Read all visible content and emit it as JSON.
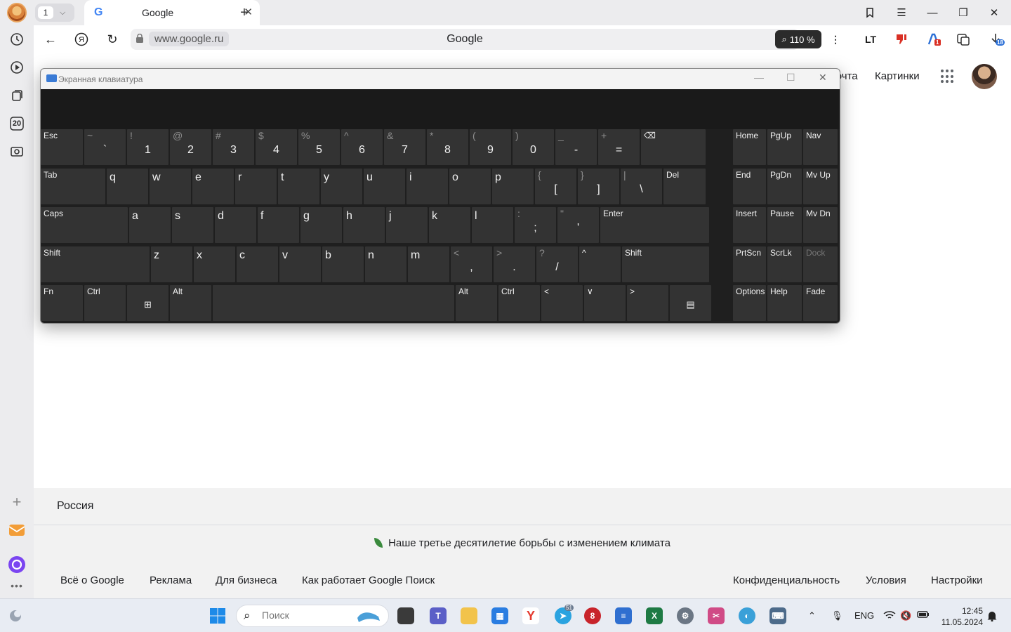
{
  "browser": {
    "tab_count": "1",
    "active_tab_title": "Google",
    "url": "www.google.ru",
    "page_title": "Google",
    "zoom_level": "110 %",
    "sidebar_calendar_number": "20",
    "download_badge": "18",
    "ext_badge": "1"
  },
  "google": {
    "header_mail": "Почта",
    "header_images": "Картинки"
  },
  "footer": {
    "country": "Россия",
    "climate_text": "Наше третье десятилетие борьбы с изменением климата",
    "links_left": [
      "Всё о Google",
      "Реклама",
      "Для бизнеса",
      "Как работает Google Поиск"
    ],
    "links_right": [
      "Конфиденциальность",
      "Условия",
      "Настройки"
    ]
  },
  "osk": {
    "window_title": "Экранная клавиатура",
    "row1": [
      {
        "label": "Esc"
      },
      {
        "top": "~",
        "bottom": "`"
      },
      {
        "top": "!",
        "bottom": "1"
      },
      {
        "top": "@",
        "bottom": "2"
      },
      {
        "top": "#",
        "bottom": "3"
      },
      {
        "top": "$",
        "bottom": "4"
      },
      {
        "top": "%",
        "bottom": "5"
      },
      {
        "top": "^",
        "bottom": "6"
      },
      {
        "top": "&",
        "bottom": "7"
      },
      {
        "top": "*",
        "bottom": "8"
      },
      {
        "top": "(",
        "bottom": "9"
      },
      {
        "top": ")",
        "bottom": "0"
      },
      {
        "top": "_",
        "bottom": "-"
      },
      {
        "top": "+",
        "bottom": "="
      },
      {
        "label": "⌫"
      }
    ],
    "row2": [
      {
        "label": "Tab"
      },
      {
        "letter": "q"
      },
      {
        "letter": "w"
      },
      {
        "letter": "e"
      },
      {
        "letter": "r"
      },
      {
        "letter": "t"
      },
      {
        "letter": "y"
      },
      {
        "letter": "u"
      },
      {
        "letter": "i"
      },
      {
        "letter": "o"
      },
      {
        "letter": "p"
      },
      {
        "top": "{",
        "bottom": "["
      },
      {
        "top": "}",
        "bottom": "]"
      },
      {
        "top": "|",
        "bottom": "\\"
      },
      {
        "label": "Del"
      }
    ],
    "row3": [
      {
        "label": "Caps"
      },
      {
        "letter": "a"
      },
      {
        "letter": "s"
      },
      {
        "letter": "d"
      },
      {
        "letter": "f"
      },
      {
        "letter": "g"
      },
      {
        "letter": "h"
      },
      {
        "letter": "j"
      },
      {
        "letter": "k"
      },
      {
        "letter": "l"
      },
      {
        "top": ":",
        "bottom": ";"
      },
      {
        "top": "\"",
        "bottom": "'"
      },
      {
        "label": "Enter"
      }
    ],
    "row4": [
      {
        "label": "Shift"
      },
      {
        "letter": "z"
      },
      {
        "letter": "x"
      },
      {
        "letter": "c"
      },
      {
        "letter": "v"
      },
      {
        "letter": "b"
      },
      {
        "letter": "n"
      },
      {
        "letter": "m"
      },
      {
        "top": "<",
        "bottom": ","
      },
      {
        "top": ">",
        "bottom": "."
      },
      {
        "top": "?",
        "bottom": "/"
      },
      {
        "label": "^"
      },
      {
        "label": "Shift"
      }
    ],
    "row5": [
      {
        "label": "Fn"
      },
      {
        "label": "Ctrl"
      },
      {
        "mid": "⊞"
      },
      {
        "label": "Alt"
      },
      {
        "label": ""
      },
      {
        "label": "Alt"
      },
      {
        "label": "Ctrl"
      },
      {
        "label": "<"
      },
      {
        "label": "∨"
      },
      {
        "label": ">"
      },
      {
        "mid": "▤"
      }
    ],
    "nav": [
      [
        "Home",
        "PgUp",
        "Nav"
      ],
      [
        "End",
        "PgDn",
        "Mv Up"
      ],
      [
        "Insert",
        "Pause",
        "Mv Dn"
      ],
      [
        "PrtScn",
        "ScrLk",
        "Dock"
      ],
      [
        "Options",
        "Help",
        "Fade"
      ]
    ]
  },
  "taskbar": {
    "search_placeholder": "Поиск",
    "language": "ENG",
    "time": "12:45",
    "date": "11.05.2024",
    "telegram_badge": "51"
  }
}
